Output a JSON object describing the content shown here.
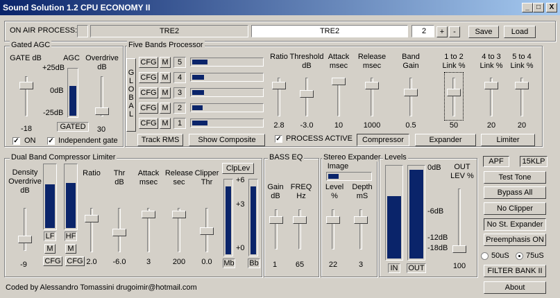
{
  "title": "Sound Solution 1.2 CPU ECONOMY II",
  "window_controls": {
    "minimize": "_",
    "maximize": "□",
    "close": "X"
  },
  "top": {
    "on_air_label": "ON AIR PROCESS:",
    "preset_display": "TRE2",
    "preset_input": "TRE2",
    "preset_number": "2",
    "plus": "+",
    "minus": "-",
    "save": "Save",
    "load": "Load"
  },
  "gated_agc": {
    "title": "Gated AGC",
    "gate_label": "GATE dB",
    "agc_label": "AGC",
    "overdrive_label": "Overdrive\ndB",
    "scale": [
      "+25dB",
      "0dB",
      "-25dB"
    ],
    "gate_value": "-18",
    "overdrive_value": "30",
    "gated_label": "GATED",
    "agc_level": 0.65,
    "on_label": "ON",
    "independent_label": "Independent gate"
  },
  "five_bands": {
    "title": "Five Bands Processor",
    "global_label": "GLOBAL",
    "bands": [
      {
        "num": "5",
        "cfg": "CFG",
        "m": "M",
        "level": 0.22
      },
      {
        "num": "4",
        "cfg": "CFG",
        "m": "M",
        "level": 0.17
      },
      {
        "num": "3",
        "cfg": "CFG",
        "m": "M",
        "level": 0.17
      },
      {
        "num": "2",
        "cfg": "CFG",
        "m": "M",
        "level": 0.15
      },
      {
        "num": "1",
        "cfg": "CFG",
        "m": "M",
        "level": 0.22
      }
    ],
    "track_rms": "Track RMS",
    "show_composite": "Show Composite",
    "process_active": "PROCESS ACTIVE",
    "columns": [
      {
        "label": "Ratio",
        "value": "2.8"
      },
      {
        "label": "Threshold\ndB",
        "value": "-3.0"
      },
      {
        "label": "Attack\nmsec",
        "value": "10"
      },
      {
        "label": "Release\nmsec",
        "value": "1000"
      },
      {
        "label": "Band\nGain",
        "value": "0.5"
      },
      {
        "label": "1 to 2\nLink %",
        "value": "50"
      },
      {
        "label": "4 to 3\nLink %",
        "value": "20"
      },
      {
        "label": "5 to 4\nLink %",
        "value": "20"
      }
    ],
    "compressor": "Compressor",
    "expander": "Expander",
    "limiter": "Limiter"
  },
  "dual_band": {
    "title": "Dual Band Compressor Limiter",
    "density_label": "Density\nOverdrive\ndB",
    "density_value": "-9",
    "lf": "LF",
    "hf": "HF",
    "m": "M",
    "cfg": "CFG",
    "lf_level": 0.7,
    "hf_level": 0.72,
    "columns": [
      {
        "label": "Ratio",
        "value": "2.0"
      },
      {
        "label": "Thr\ndB",
        "value": "-6.0"
      },
      {
        "label": "Attack\nmsec",
        "value": "3"
      },
      {
        "label": "Release\nsec",
        "value": "200"
      },
      {
        "label": "Clipper\nThr",
        "value": "0.0"
      }
    ],
    "clplev": "ClpLev",
    "clp_scale": [
      "+6",
      "+3",
      "+0"
    ],
    "mb": "Mb",
    "bb": "Bb",
    "mb_level": 0.92,
    "bb_level": 0.92
  },
  "bass_eq": {
    "title": "BASS EQ",
    "gain_label": "Gain\ndB",
    "freq_label": "FREQ\nHz",
    "gain_value": "1",
    "freq_value": "65"
  },
  "stereo": {
    "title": "Stereo Expander",
    "image_label": "Image",
    "image_level": 0.25,
    "level_label": "Level\n%",
    "depth_label": "Depth\nmS",
    "level_value": "22",
    "depth_value": "3"
  },
  "levels": {
    "title": "Levels",
    "scale": [
      "0dB",
      "-6dB",
      "-12dB",
      "-18dB"
    ],
    "in_label": "IN",
    "out_label": "OUT",
    "in_level": 0.68,
    "out_level": 0.97,
    "out_lev_label": "OUT\nLEV %",
    "out_lev_value": "100"
  },
  "right": {
    "apf": "APF",
    "klp": "15KLP",
    "test_tone": "Test Tone",
    "bypass_all": "Bypass All",
    "no_clipper": "No Clipper",
    "no_st_expander": "No St. Expander",
    "preemphasis": "Preemphasis ON",
    "r50": "50uS",
    "r75": "75uS",
    "filter_bank": "FILTER BANK II",
    "about": "About"
  },
  "footer": "Coded by Alessandro Tomassini drugoimir@hotmail.com"
}
